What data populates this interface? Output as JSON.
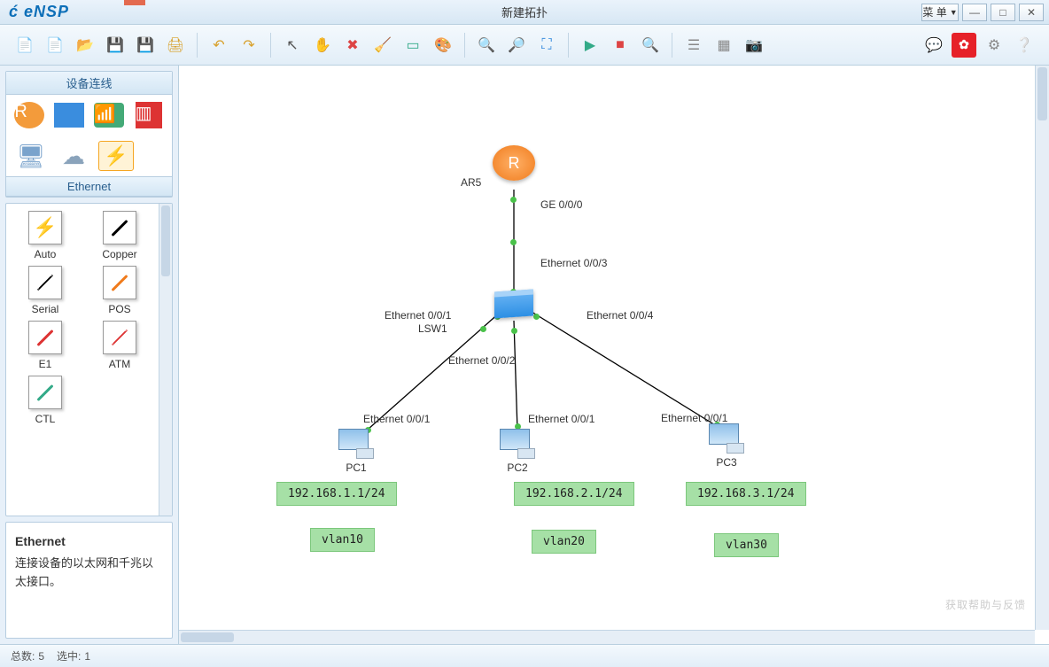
{
  "app": {
    "logo": "eNSP",
    "title": "新建拓扑"
  },
  "titlebar": {
    "menu": "菜 单"
  },
  "side": {
    "header1": "设备连线",
    "header2": "Ethernet",
    "links": {
      "auto": "Auto",
      "copper": "Copper",
      "serial": "Serial",
      "pos": "POS",
      "e1": "E1",
      "atm": "ATM",
      "ctl": "CTL"
    },
    "hint": {
      "title": "Ethernet",
      "body": "连接设备的以太网和千兆以太接口。"
    }
  },
  "topo": {
    "ar5": "AR5",
    "lsw1": "LSW1",
    "pc1": "PC1",
    "pc2": "PC2",
    "pc3": "PC3",
    "ge000": "GE 0/0/0",
    "eth003": "Ethernet 0/0/3",
    "eth001_sw": "Ethernet 0/0/1",
    "eth002_sw": "Ethernet 0/0/2",
    "eth004_sw": "Ethernet 0/0/4",
    "eth001_pc1": "Ethernet 0/0/1",
    "eth001_pc2": "Ethernet 0/0/1",
    "eth001_pc3": "Ethernet 0/0/1",
    "ip1": "192.168.1.1/24",
    "ip2": "192.168.2.1/24",
    "ip3": "192.168.3.1/24",
    "vlan10": "vlan10",
    "vlan20": "vlan20",
    "vlan30": "vlan30"
  },
  "status": {
    "total_label": "总数:",
    "total": "5",
    "sel_label": "选中:",
    "sel": "1"
  },
  "watermark": "获取帮助与反馈"
}
